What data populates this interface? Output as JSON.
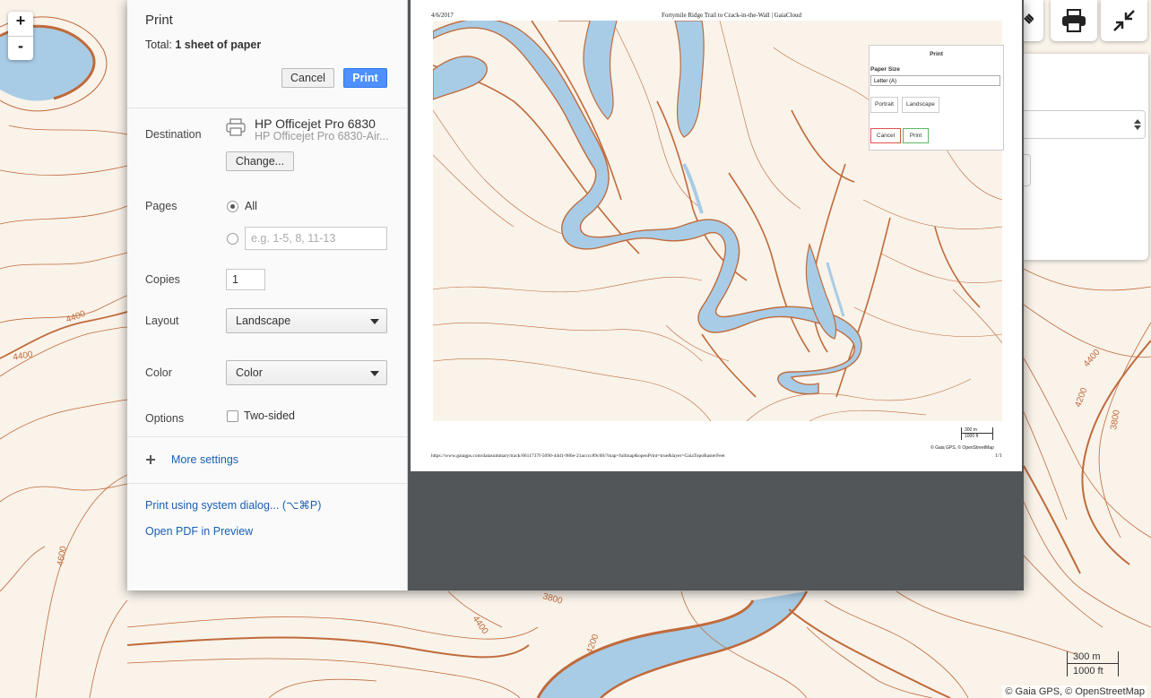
{
  "map": {
    "zoom_in": "+",
    "zoom_out": "-",
    "contour_labels": [
      "4400",
      "4400",
      "4600",
      "3800",
      "4400",
      "4200",
      "4200",
      "4400",
      "3800"
    ],
    "scale_metric": "300 m",
    "scale_imperial": "1000 ft",
    "attribution": "© Gaia GPS, © OpenStreetMap",
    "water_color": "#a8cce6",
    "contour_color": "#c06a3a"
  },
  "print_dialog": {
    "title": "Print",
    "total_label": "Total:",
    "total_value": "1 sheet of paper",
    "cancel_label": "Cancel",
    "print_label": "Print",
    "destination": {
      "label": "Destination",
      "printer_name": "HP Officejet Pro 6830",
      "printer_sub": "HP Officejet Pro 6830-Air...",
      "change_label": "Change..."
    },
    "pages": {
      "label": "Pages",
      "all_label": "All",
      "custom_placeholder": "e.g. 1-5, 8, 11-13"
    },
    "copies": {
      "label": "Copies",
      "value": "1"
    },
    "layout": {
      "label": "Layout",
      "value": "Landscape"
    },
    "color": {
      "label": "Color",
      "value": "Color"
    },
    "options": {
      "label": "Options",
      "two_sided_label": "Two-sided"
    },
    "more_settings": "More settings",
    "system_dialog_link": "Print using system dialog... (⌥⌘P)",
    "open_pdf_link": "Open PDF in Preview"
  },
  "preview_page": {
    "date": "4/6/2017",
    "title": "Fortymile Ridge Trail to Crack-in-the-Wall | GaiaCloud",
    "popup": {
      "title": "Print",
      "paper_size_label": "Paper Size",
      "paper_size_value": "Letter (A)",
      "portrait": "Portrait",
      "landscape": "Landscape",
      "cancel": "Cancel",
      "print": "Print"
    },
    "scale_metric": "300 m",
    "scale_imperial": "1000 ft",
    "attribution": "© Gaia GPS, © OpenStreetMap",
    "url": "https://www.gaiagps.com/datasummary/track/8611737f-5090-44d1-986e-21acccc89c60/?map=fullmap&openPrint=true&layer=GaiaTopoRasterFeet",
    "page_number": "1/1"
  }
}
